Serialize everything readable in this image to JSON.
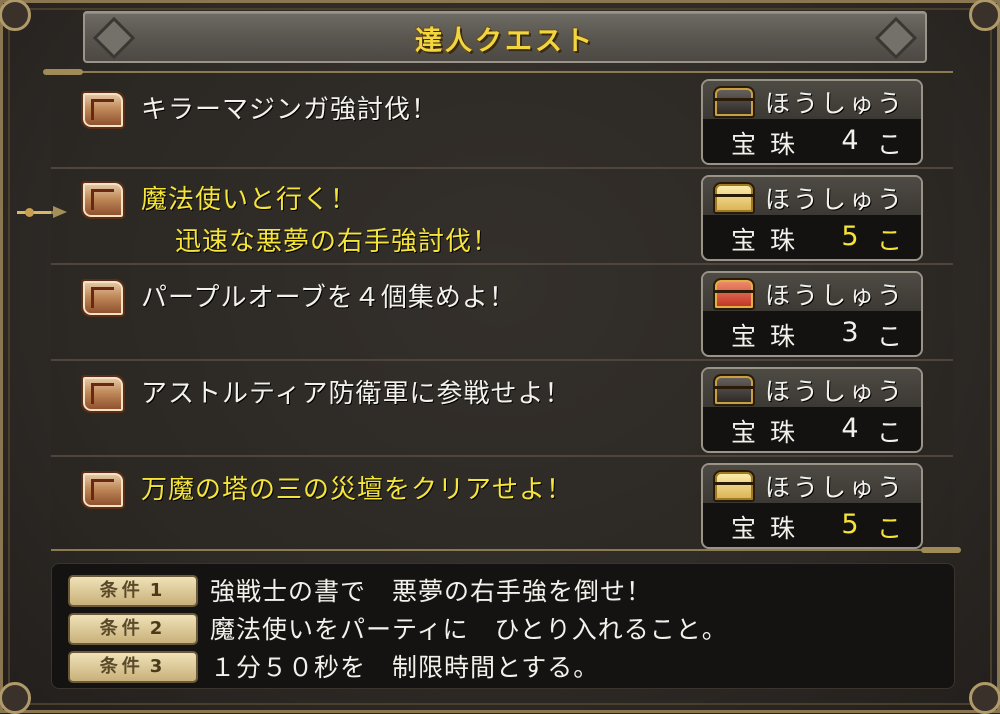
{
  "title": "達人クエスト",
  "quests": [
    {
      "lines": [
        "キラーマジンガ強討伐！"
      ],
      "highlight": false,
      "reward": {
        "header": "ほうしゅう",
        "chest": "black-chest",
        "item": "宝珠",
        "count": "4",
        "unit": "こ",
        "count_highlight": false
      }
    },
    {
      "lines": [
        "魔法使いと行く！",
        "迅速な悪夢の右手強討伐！"
      ],
      "highlight": true,
      "selected": true,
      "reward": {
        "header": "ほうしゅう",
        "chest": "gold-chest",
        "item": "宝珠",
        "count": "5",
        "unit": "こ",
        "count_highlight": true
      }
    },
    {
      "lines": [
        "パープルオーブを４個集めよ！"
      ],
      "highlight": false,
      "reward": {
        "header": "ほうしゅう",
        "chest": "red-chest",
        "item": "宝珠",
        "count": "3",
        "unit": "こ",
        "count_highlight": false
      }
    },
    {
      "lines": [
        "アストルティア防衛軍に参戦せよ！"
      ],
      "highlight": false,
      "reward": {
        "header": "ほうしゅう",
        "chest": "black-chest",
        "item": "宝珠",
        "count": "4",
        "unit": "こ",
        "count_highlight": false
      }
    },
    {
      "lines": [
        "万魔の塔の三の災壇をクリアせよ！"
      ],
      "highlight": true,
      "reward": {
        "header": "ほうしゅう",
        "chest": "gold-chest",
        "item": "宝珠",
        "count": "5",
        "unit": "こ",
        "count_highlight": true
      }
    }
  ],
  "conditions": [
    {
      "tag": "条件",
      "num": "1",
      "text": "強戦士の書で　悪夢の右手強を倒せ！"
    },
    {
      "tag": "条件",
      "num": "2",
      "text": "魔法使いをパーティに　ひとり入れること。"
    },
    {
      "tag": "条件",
      "num": "3",
      "text": "１分５０秒を　制限時間とする。"
    }
  ],
  "colors": {
    "highlight": "#f5e43a",
    "text": "#f3f1ec",
    "frame": "#8a7650"
  }
}
